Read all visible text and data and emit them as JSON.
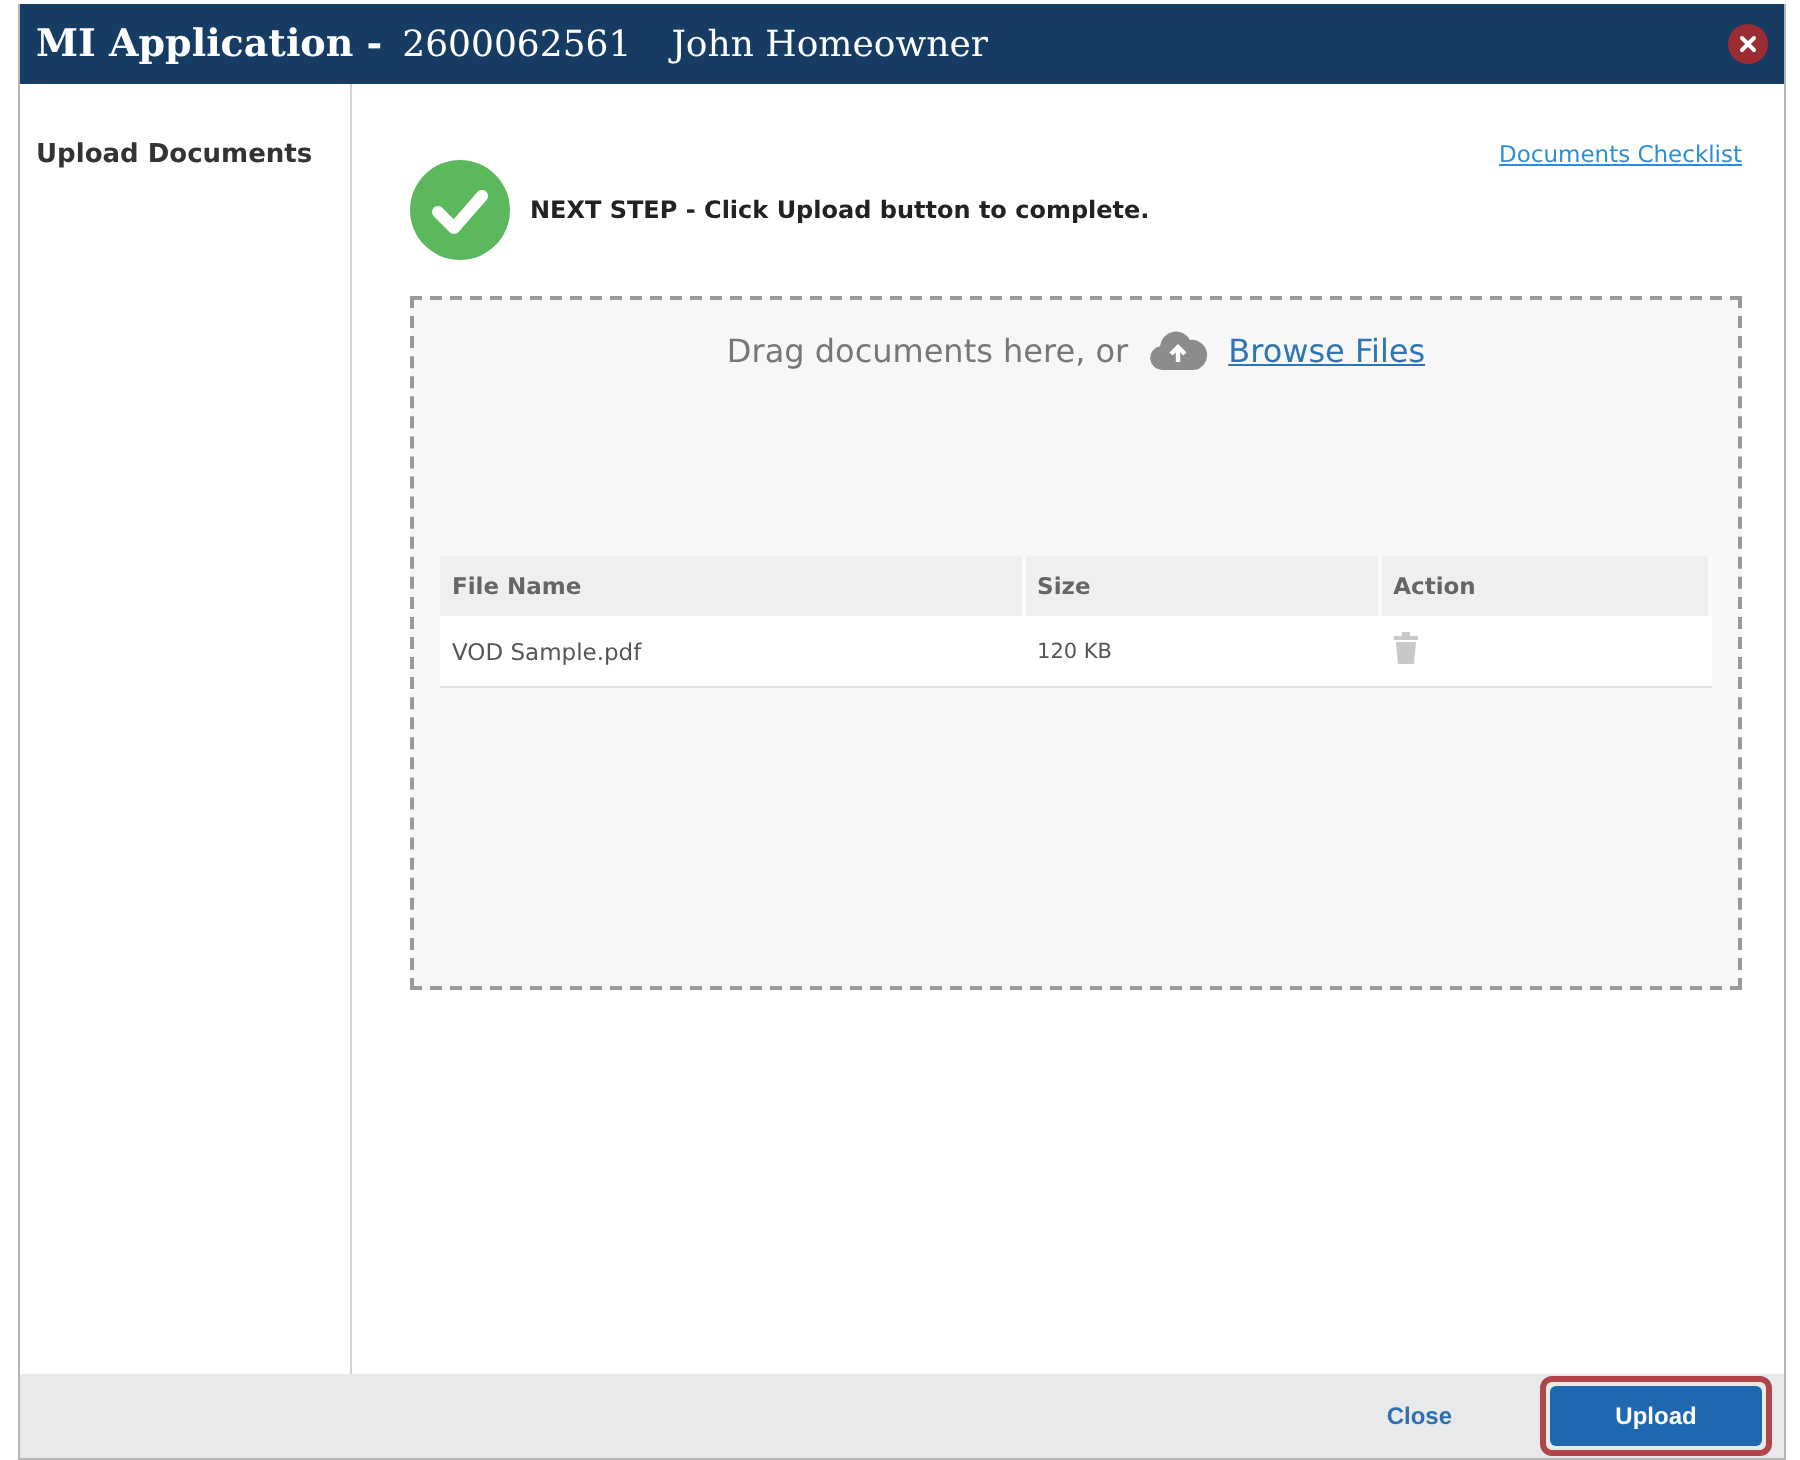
{
  "window": {
    "title": "MI Application -",
    "loan_number": "2600062561",
    "borrower": "John Homeowner"
  },
  "sidebar": {
    "items": [
      {
        "label": "Upload Documents"
      }
    ]
  },
  "checklist_link": "Documents Checklist",
  "next_step": {
    "text": "NEXT STEP - Click Upload button to complete."
  },
  "dropzone": {
    "prompt": "Drag documents here, or",
    "browse_link": "Browse Files"
  },
  "table": {
    "columns": [
      "File Name",
      "Size",
      "Action"
    ],
    "rows": [
      {
        "file_name": "VOD Sample.pdf",
        "size": "120 KB"
      }
    ]
  },
  "footer": {
    "buttons": [
      {
        "label": "Close",
        "kind": "link",
        "highlighted": false
      },
      {
        "label": "Upload",
        "kind": "primary",
        "highlighted": true
      }
    ]
  }
}
